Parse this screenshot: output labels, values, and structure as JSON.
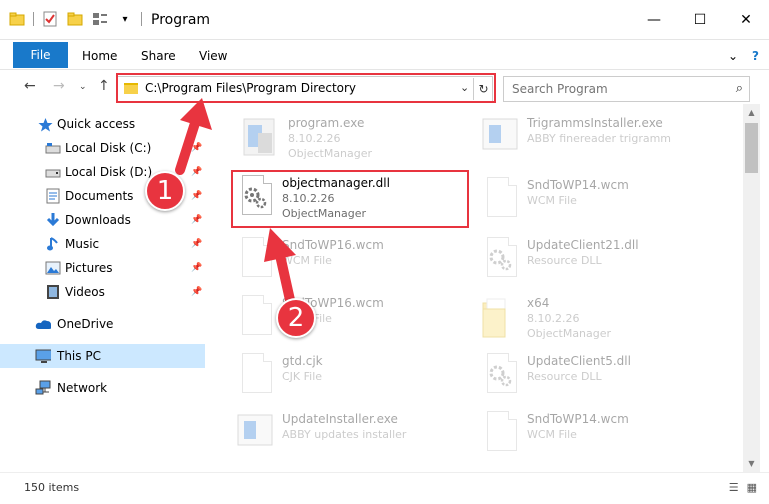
{
  "window": {
    "title": "Program",
    "controls": {
      "minimize": "—",
      "maximize": "☐",
      "close": "✕"
    }
  },
  "ribbon": {
    "file": "File",
    "tabs": [
      "Home",
      "Share",
      "View"
    ],
    "expand": "⌄",
    "help": "?"
  },
  "address": {
    "path": "C:\\Program Files\\Program Directory",
    "dropdown": "⌄",
    "refresh": "↻"
  },
  "search": {
    "placeholder": "Search Program",
    "icon": "⌕"
  },
  "sidebar": {
    "items": [
      {
        "label": "Quick access",
        "icon": "star-icon",
        "pinned": false
      },
      {
        "label": "Local Disk (C:)",
        "icon": "drive-icon",
        "pinned": true
      },
      {
        "label": "Local Disk (D:)",
        "icon": "drive-icon",
        "pinned": true
      },
      {
        "label": "Documents",
        "icon": "documents-icon",
        "pinned": true
      },
      {
        "label": "Downloads",
        "icon": "downloads-icon",
        "pinned": true
      },
      {
        "label": "Music",
        "icon": "music-icon",
        "pinned": true
      },
      {
        "label": "Pictures",
        "icon": "pictures-icon",
        "pinned": true
      },
      {
        "label": "Videos",
        "icon": "videos-icon",
        "pinned": true
      },
      {
        "label": "OneDrive",
        "icon": "onedrive-icon",
        "pinned": false
      },
      {
        "label": "This PC",
        "icon": "computer-icon",
        "pinned": false,
        "selected": true
      },
      {
        "label": "Network",
        "icon": "network-icon",
        "pinned": false
      }
    ]
  },
  "files": {
    "left": [
      {
        "name": "program.exe",
        "l2": "8.10.2.26",
        "l3": "ObjectManager",
        "icon": "exe-icon",
        "faded": true
      },
      {
        "name": "objectmanager.dll",
        "l2": "8.10.2.26",
        "l3": "ObjectManager",
        "icon": "dll-gear-icon",
        "faded": false
      },
      {
        "name": "SndToWP16.wcm",
        "l2": "WCM File",
        "l3": "",
        "icon": "file-icon",
        "faded": true
      },
      {
        "name": "SndToWP16.wcm",
        "l2": "WCM File",
        "l3": "",
        "icon": "file-icon",
        "faded": true
      },
      {
        "name": "gtd.cjk",
        "l2": "CJK File",
        "l3": "",
        "icon": "file-icon",
        "faded": true
      },
      {
        "name": "UpdateInstaller.exe",
        "l2": "ABBY updates installer",
        "l3": "",
        "icon": "exe-icon",
        "faded": true
      }
    ],
    "right": [
      {
        "name": "TrigrammsInstaller.exe",
        "l2": "ABBY finereader trigramm",
        "l3": "",
        "icon": "exe-icon",
        "faded": true
      },
      {
        "name": "SndToWP14.wcm",
        "l2": "WCM File",
        "l3": "",
        "icon": "file-icon",
        "faded": true
      },
      {
        "name": "UpdateClient21.dll",
        "l2": "Resource DLL",
        "l3": "",
        "icon": "dll-gear-icon",
        "faded": true
      },
      {
        "name": "x64",
        "l2": "8.10.2.26",
        "l3": "ObjectManager",
        "icon": "folder-icon",
        "faded": true
      },
      {
        "name": "UpdateClient5.dll",
        "l2": "Resource DLL",
        "l3": "",
        "icon": "dll-gear-icon",
        "faded": true
      },
      {
        "name": "SndToWP14.wcm",
        "l2": "WCM File",
        "l3": "",
        "icon": "file-icon",
        "faded": true
      }
    ]
  },
  "status": {
    "count": "150 items"
  },
  "callouts": {
    "one": "1",
    "two": "2"
  },
  "colors": {
    "accent": "#1979ca",
    "highlight": "#e8343f",
    "selected": "#cce8ff"
  }
}
